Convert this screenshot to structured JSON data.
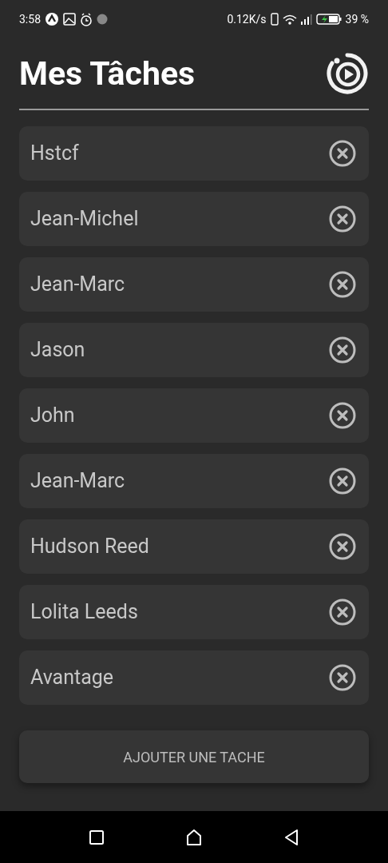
{
  "status_bar": {
    "time": "3:58",
    "network_speed": "0.12K/s",
    "battery": "39 %"
  },
  "header": {
    "title": "Mes Tâches"
  },
  "tasks": [
    {
      "text": "Hstcf"
    },
    {
      "text": "Jean-Michel"
    },
    {
      "text": "Jean-Marc"
    },
    {
      "text": "Jason"
    },
    {
      "text": "John"
    },
    {
      "text": "Jean-Marc"
    },
    {
      "text": "Hudson Reed"
    },
    {
      "text": "Lolita Leeds"
    },
    {
      "text": "Avantage"
    }
  ],
  "add_button": {
    "label": "AJOUTER UNE TACHE"
  }
}
